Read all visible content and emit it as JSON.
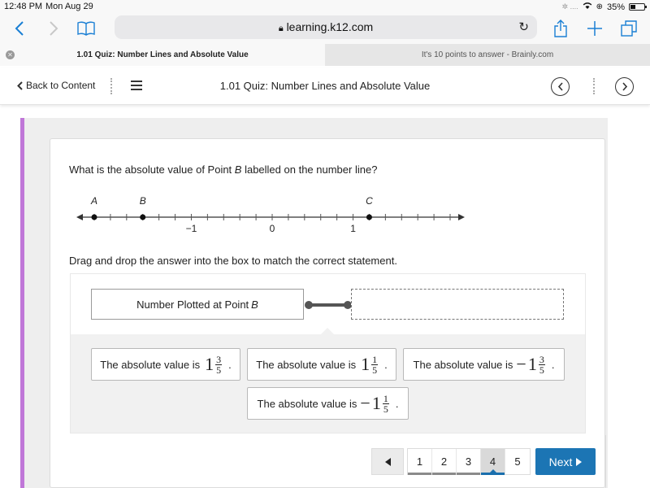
{
  "status_bar": {
    "time": "12:48 PM",
    "date": "Mon Aug 29",
    "battery_percent": "35%",
    "battery_level": 0.35
  },
  "browser": {
    "url": "learning.k12.com",
    "icons": {
      "back": "chevron-left-icon",
      "forward": "chevron-right-icon",
      "bookmarks": "book-icon",
      "lock": "lock-icon",
      "reload": "reload-icon",
      "share": "share-icon",
      "new_tab": "plus-icon",
      "tabs": "tabs-icon"
    },
    "tabs": [
      {
        "label": "1.01 Quiz: Number Lines and Absolute Value",
        "active": true
      },
      {
        "label": "It's 10 points to answer - Brainly.com",
        "active": false
      }
    ]
  },
  "app_header": {
    "back_label": "Back to Content",
    "title": "1.01 Quiz: Number Lines and Absolute Value"
  },
  "question": {
    "prompt_before": "What is the absolute value of Point ",
    "prompt_var": "B",
    "prompt_after": " labelled on the number line?",
    "number_line": {
      "min_tick": -2.2,
      "max_tick": 2.2,
      "tick_step": 0.2,
      "labels": [
        {
          "value": -1,
          "text": "−1"
        },
        {
          "value": 0,
          "text": "0"
        },
        {
          "value": 1,
          "text": "1"
        }
      ],
      "points": [
        {
          "name": "A",
          "value": -2.2
        },
        {
          "name": "B",
          "value": -1.6
        },
        {
          "name": "C",
          "value": 1.2
        }
      ]
    },
    "instruction": "Drag and drop the answer into the box to match the correct statement.",
    "statement_before": "Number Plotted at Point ",
    "statement_var": "B",
    "answer_choices": [
      {
        "prefix": "The absolute value is",
        "sign": "",
        "whole": "1",
        "num": "3",
        "den": "5"
      },
      {
        "prefix": "The absolute value is",
        "sign": "",
        "whole": "1",
        "num": "1",
        "den": "5"
      },
      {
        "prefix": "The absolute value is",
        "sign": "−",
        "whole": "1",
        "num": "3",
        "den": "5"
      },
      {
        "prefix": "The absolute value is",
        "sign": "−",
        "whole": "1",
        "num": "1",
        "den": "5"
      }
    ]
  },
  "pagination": {
    "prev_icon": "triangle-left-icon",
    "pages": [
      "1",
      "2",
      "3",
      "4",
      "5"
    ],
    "current_page": "4",
    "next_label": "Next",
    "next_icon": "triangle-right-icon"
  },
  "colors": {
    "accent_bar": "#c077d8",
    "next_button": "#1c75b4",
    "browser_blue": "#1a7fd4"
  }
}
